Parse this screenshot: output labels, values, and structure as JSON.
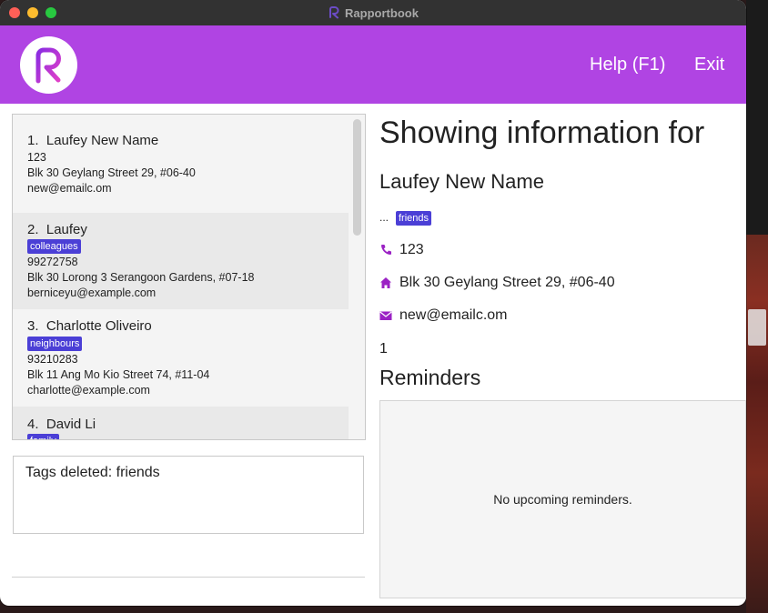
{
  "window": {
    "title": "Rapportbook"
  },
  "header": {
    "logo": "rapportbook-logo",
    "menu": [
      {
        "label": "Help (F1)"
      },
      {
        "label": "Exit"
      }
    ]
  },
  "persons": [
    {
      "index": "1.",
      "name": "Laufey New Name",
      "tags": [],
      "phone": "123",
      "address": "Blk 30 Geylang Street 29, #06-40",
      "email": "new@emailc.om"
    },
    {
      "index": "2.",
      "name": "Laufey",
      "tags": [
        "colleagues"
      ],
      "phone": "99272758",
      "address": "Blk 30 Lorong 3 Serangoon Gardens, #07-18",
      "email": "berniceyu@example.com"
    },
    {
      "index": "3.",
      "name": "Charlotte Oliveiro",
      "tags": [
        "neighbours"
      ],
      "phone": "93210283",
      "address": "Blk 11 Ang Mo Kio Street 74, #11-04",
      "email": "charlotte@example.com"
    },
    {
      "index": "4.",
      "name": "David Li",
      "tags": [
        "family"
      ],
      "phone": "",
      "address": "",
      "email": ""
    }
  ],
  "result": {
    "message": "Tags deleted: friends"
  },
  "details": {
    "heading": "Showing information for",
    "name": "Laufey New Name",
    "ellipsis": "...",
    "tag": "friends",
    "phone": "123",
    "address": "Blk 30 Geylang Street 29, #06-40",
    "email": "new@emailc.om",
    "count": "1",
    "reminders_title": "Reminders",
    "reminders_empty": "No upcoming reminders."
  },
  "colors": {
    "header": "#b044e3",
    "tag": "#4b3fd6",
    "icon": "#9b22c4"
  }
}
